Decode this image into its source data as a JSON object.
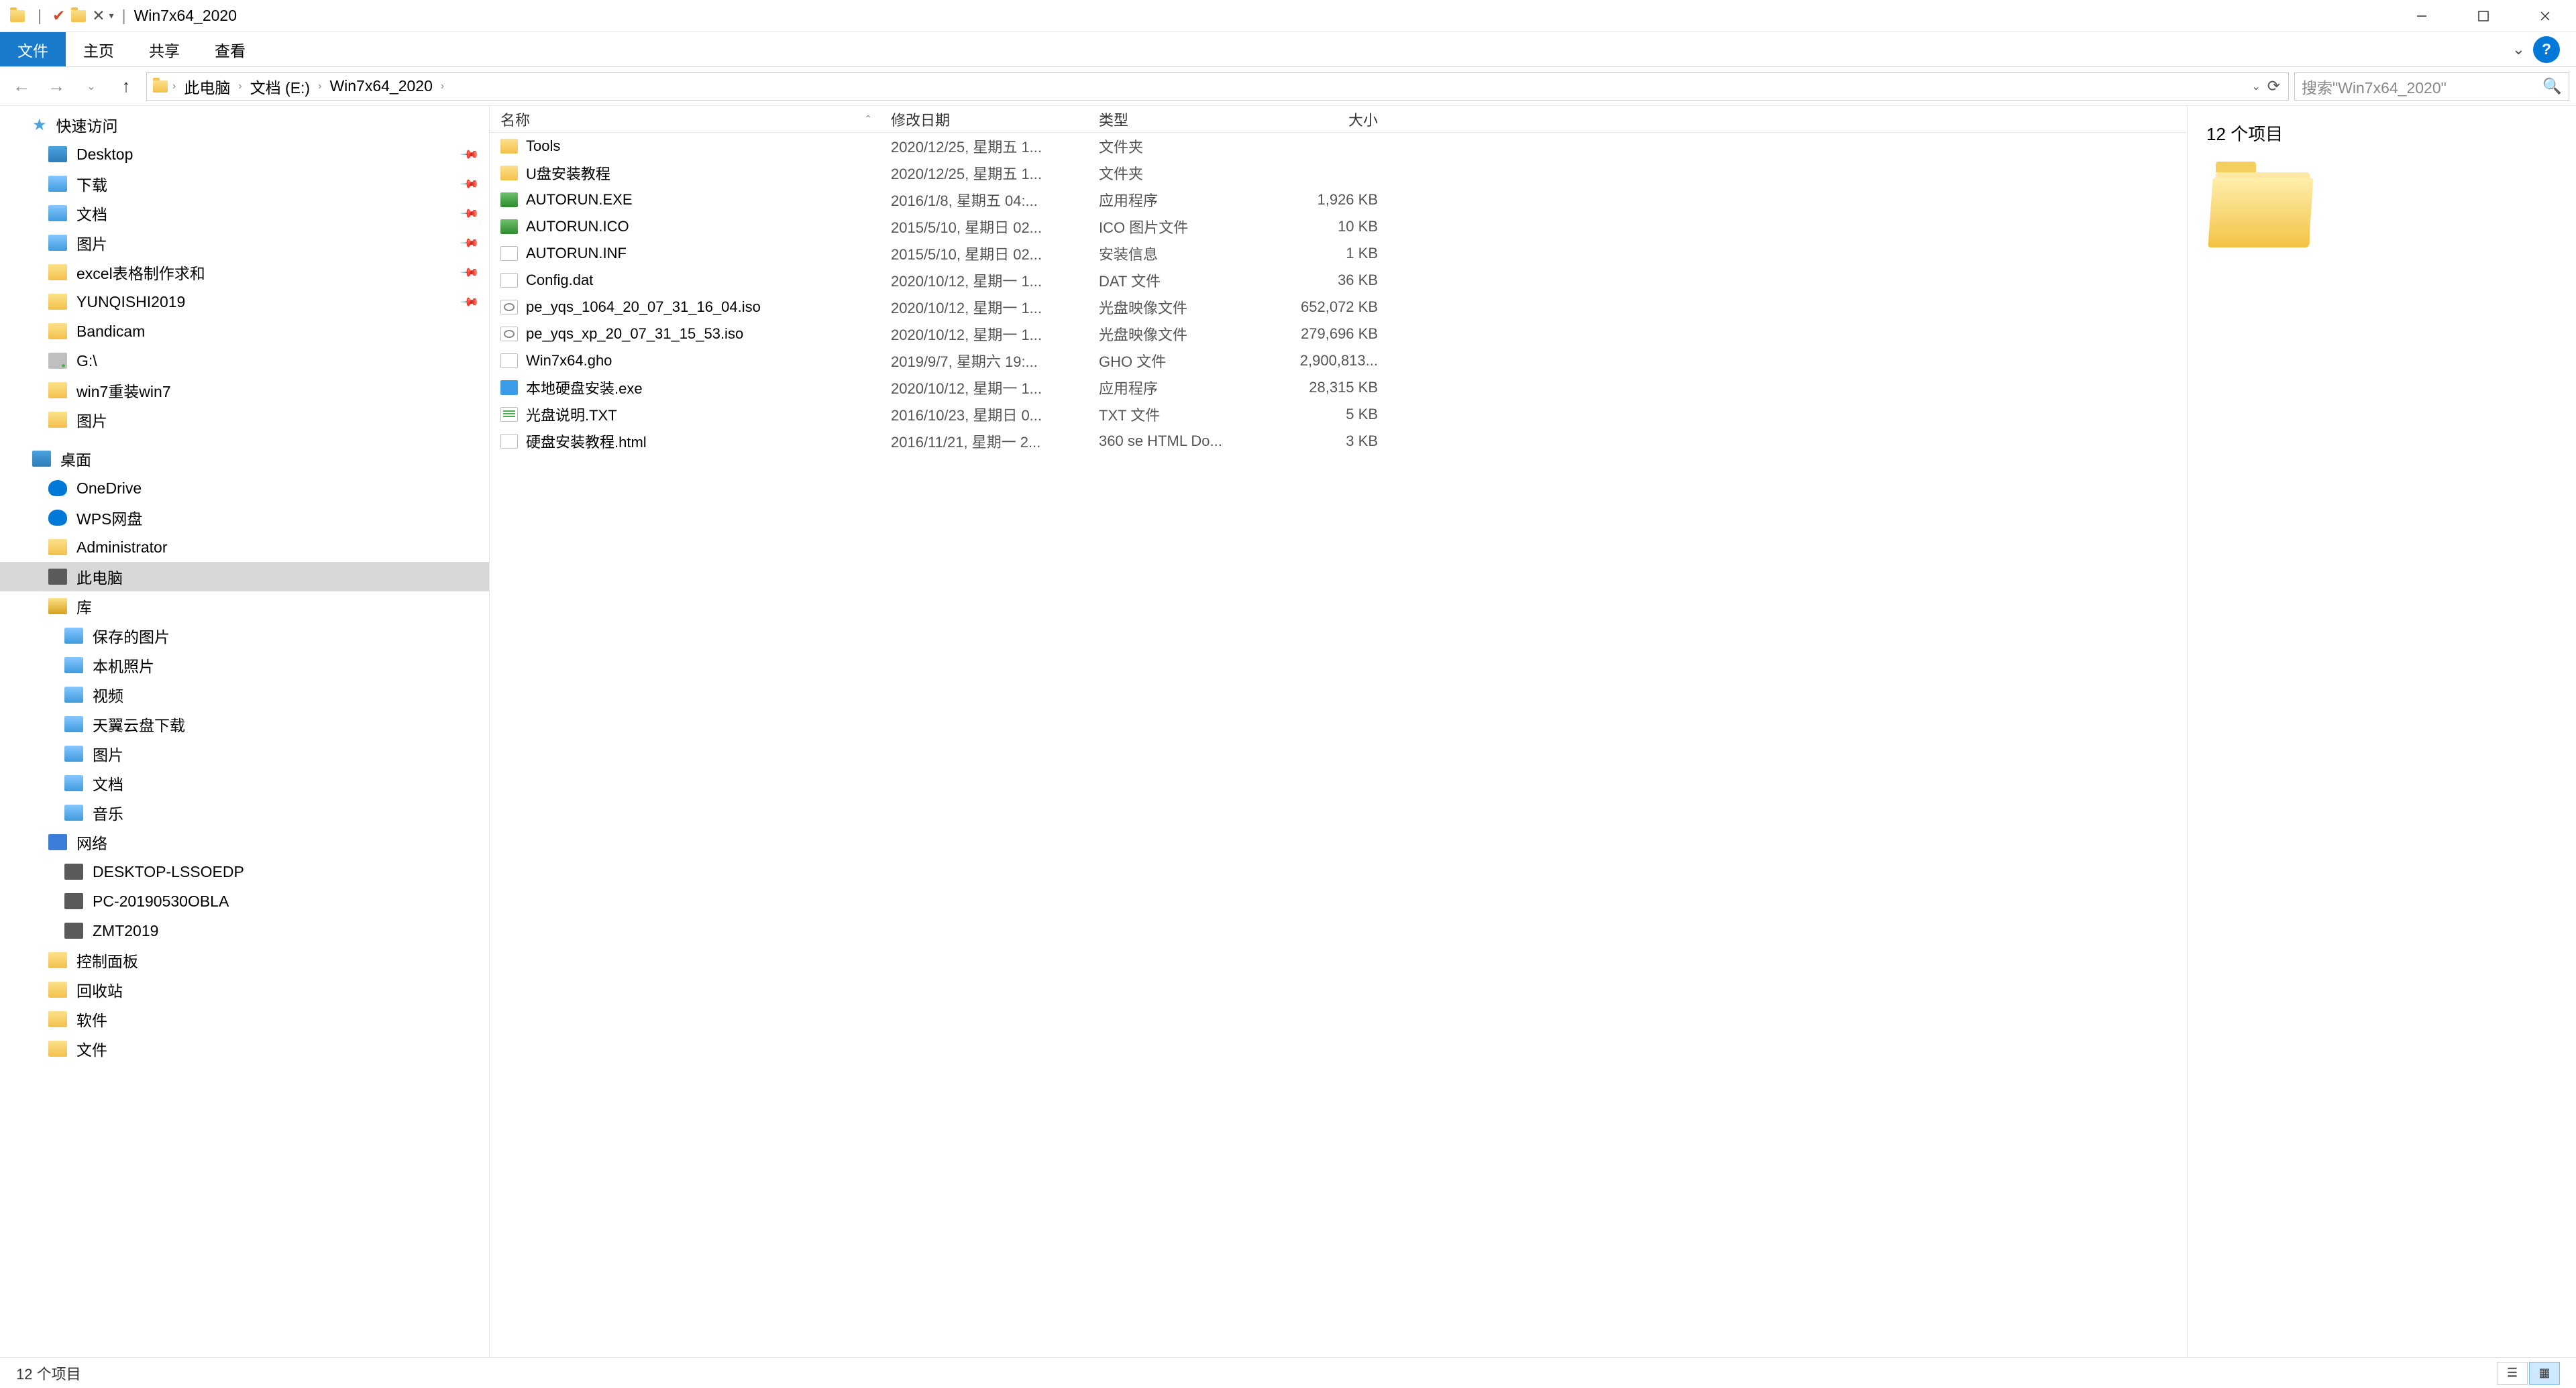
{
  "window": {
    "title": "Win7x64_2020",
    "separator": "|"
  },
  "ribbon": {
    "file": "文件",
    "home": "主页",
    "share": "共享",
    "view": "查看"
  },
  "breadcrumb": {
    "items": [
      "此电脑",
      "文档 (E:)",
      "Win7x64_2020"
    ]
  },
  "search": {
    "placeholder": "搜索\"Win7x64_2020\""
  },
  "sidebar": {
    "quickaccess": "快速访问",
    "qa_items": [
      {
        "label": "Desktop",
        "icon": "ic-desktop",
        "pinned": true
      },
      {
        "label": "下载",
        "icon": "ic-folder-blue",
        "pinned": true
      },
      {
        "label": "文档",
        "icon": "ic-folder-blue",
        "pinned": true
      },
      {
        "label": "图片",
        "icon": "ic-folder-blue",
        "pinned": true
      },
      {
        "label": "excel表格制作求和",
        "icon": "ic-folder",
        "pinned": true
      },
      {
        "label": "YUNQISHI2019",
        "icon": "ic-folder",
        "pinned": true
      },
      {
        "label": "Bandicam",
        "icon": "ic-folder",
        "pinned": false
      },
      {
        "label": "G:\\",
        "icon": "ic-drive",
        "pinned": false
      },
      {
        "label": "win7重装win7",
        "icon": "ic-folder",
        "pinned": false
      },
      {
        "label": "图片",
        "icon": "ic-folder",
        "pinned": false
      }
    ],
    "desktop": "桌面",
    "desktop_items": [
      {
        "label": "OneDrive",
        "icon": "ic-cloud"
      },
      {
        "label": "WPS网盘",
        "icon": "ic-cloud"
      },
      {
        "label": "Administrator",
        "icon": "ic-folder"
      },
      {
        "label": "此电脑",
        "icon": "ic-pc",
        "selected": true
      },
      {
        "label": "库",
        "icon": "ic-lib"
      }
    ],
    "lib_items": [
      {
        "label": "保存的图片"
      },
      {
        "label": "本机照片"
      },
      {
        "label": "视频"
      },
      {
        "label": "天翼云盘下载"
      },
      {
        "label": "图片"
      },
      {
        "label": "文档"
      },
      {
        "label": "音乐"
      }
    ],
    "network": "网络",
    "net_items": [
      {
        "label": "DESKTOP-LSSOEDP"
      },
      {
        "label": "PC-20190530OBLA"
      },
      {
        "label": "ZMT2019"
      }
    ],
    "extras": [
      {
        "label": "控制面板",
        "icon": "ic-folder"
      },
      {
        "label": "回收站",
        "icon": "ic-folder"
      },
      {
        "label": "软件",
        "icon": "ic-folder"
      },
      {
        "label": "文件",
        "icon": "ic-folder"
      }
    ]
  },
  "columns": {
    "name": "名称",
    "date": "修改日期",
    "type": "类型",
    "size": "大小"
  },
  "files": [
    {
      "name": "Tools",
      "date": "2020/12/25, 星期五 1...",
      "type": "文件夹",
      "size": "",
      "icon": "fi-folder"
    },
    {
      "name": "U盘安装教程",
      "date": "2020/12/25, 星期五 1...",
      "type": "文件夹",
      "size": "",
      "icon": "fi-folder"
    },
    {
      "name": "AUTORUN.EXE",
      "date": "2016/1/8, 星期五 04:...",
      "type": "应用程序",
      "size": "1,926 KB",
      "icon": "fi-exe"
    },
    {
      "name": "AUTORUN.ICO",
      "date": "2015/5/10, 星期日 02...",
      "type": "ICO 图片文件",
      "size": "10 KB",
      "icon": "fi-ico"
    },
    {
      "name": "AUTORUN.INF",
      "date": "2015/5/10, 星期日 02...",
      "type": "安装信息",
      "size": "1 KB",
      "icon": "fi-generic"
    },
    {
      "name": "Config.dat",
      "date": "2020/10/12, 星期一 1...",
      "type": "DAT 文件",
      "size": "36 KB",
      "icon": "fi-generic"
    },
    {
      "name": "pe_yqs_1064_20_07_31_16_04.iso",
      "date": "2020/10/12, 星期一 1...",
      "type": "光盘映像文件",
      "size": "652,072 KB",
      "icon": "fi-iso"
    },
    {
      "name": "pe_yqs_xp_20_07_31_15_53.iso",
      "date": "2020/10/12, 星期一 1...",
      "type": "光盘映像文件",
      "size": "279,696 KB",
      "icon": "fi-iso"
    },
    {
      "name": "Win7x64.gho",
      "date": "2019/9/7, 星期六 19:...",
      "type": "GHO 文件",
      "size": "2,900,813...",
      "icon": "fi-gho"
    },
    {
      "name": "本地硬盘安装.exe",
      "date": "2020/10/12, 星期一 1...",
      "type": "应用程序",
      "size": "28,315 KB",
      "icon": "fi-app"
    },
    {
      "name": "光盘说明.TXT",
      "date": "2016/10/23, 星期日 0...",
      "type": "TXT 文件",
      "size": "5 KB",
      "icon": "fi-txt"
    },
    {
      "name": "硬盘安装教程.html",
      "date": "2016/11/21, 星期一 2...",
      "type": "360 se HTML Do...",
      "size": "3 KB",
      "icon": "fi-html"
    }
  ],
  "preview": {
    "title": "12 个项目"
  },
  "statusbar": {
    "text": "12 个项目"
  }
}
